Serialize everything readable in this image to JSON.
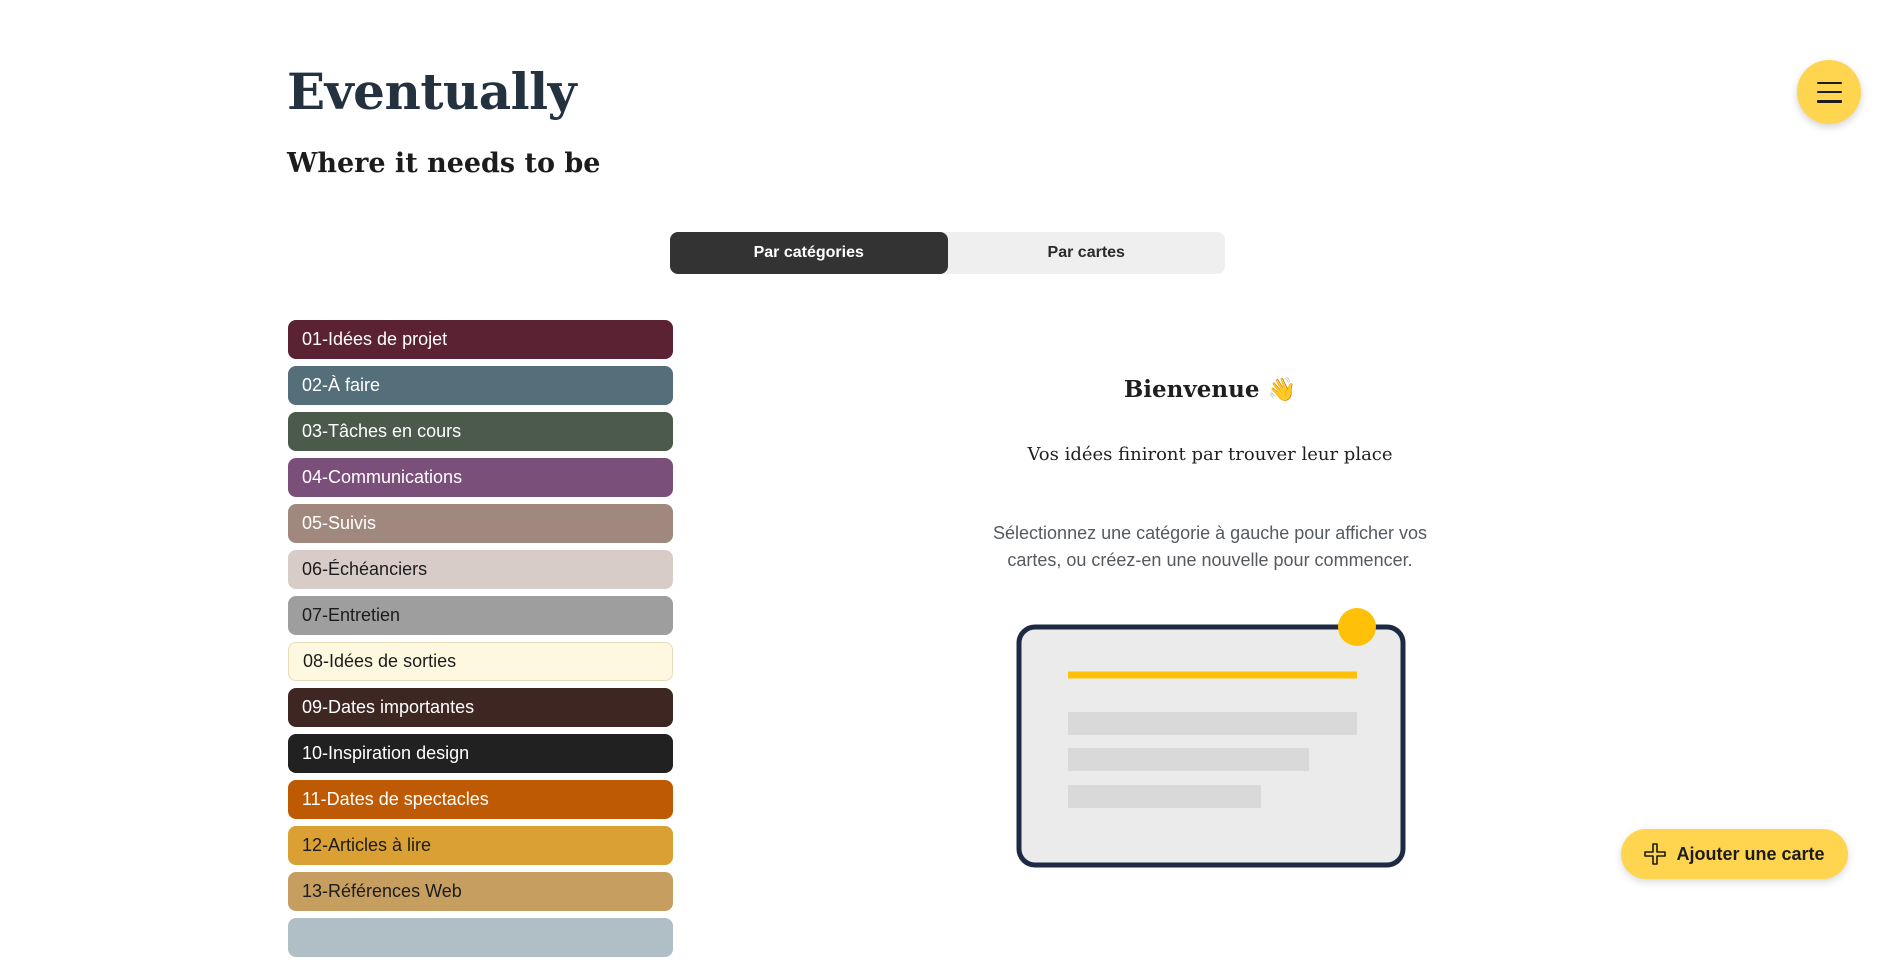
{
  "header": {
    "title": "Eventually",
    "subtitle": "Where it needs to be"
  },
  "menu": {
    "icon": "hamburger-icon"
  },
  "tabs": [
    {
      "label": "Par catégories",
      "active": true
    },
    {
      "label": "Par cartes",
      "active": false
    }
  ],
  "categories": [
    {
      "label": "01-Idées de projet",
      "color": "#5a2233",
      "text_color": "#ffffff"
    },
    {
      "label": "02-À faire",
      "color": "#546e7a",
      "text_color": "#ffffff"
    },
    {
      "label": "03-Tâches en cours",
      "color": "#4b5a4a",
      "text_color": "#ffffff"
    },
    {
      "label": "04-Communications",
      "color": "#7a4f7a",
      "text_color": "#ffffff"
    },
    {
      "label": "05-Suivis",
      "color": "#a1887f",
      "text_color": "#ffffff"
    },
    {
      "label": "06-Échéanciers",
      "color": "#d7ccc8",
      "text_color": "#1c1c1c"
    },
    {
      "label": "07-Entretien",
      "color": "#9e9e9e",
      "text_color": "#1c1c1c"
    },
    {
      "label": "08-Idées de sorties",
      "color": "#fff8e1",
      "text_color": "#1c1c1c"
    },
    {
      "label": "09-Dates importantes",
      "color": "#3e2723",
      "text_color": "#ffffff"
    },
    {
      "label": "10-Inspiration design",
      "color": "#212121",
      "text_color": "#ffffff"
    },
    {
      "label": "11-Dates de spectacles",
      "color": "#bf5a04",
      "text_color": "#ffffff"
    },
    {
      "label": "12-Articles à lire",
      "color": "#dba033",
      "text_color": "#1c1c1c"
    },
    {
      "label": "13-Références Web",
      "color": "#c69e5f",
      "text_color": "#1c1c1c"
    },
    {
      "label": "",
      "color": "#b0bec5",
      "text_color": "#1c1c1c"
    }
  ],
  "welcome": {
    "title": "Bienvenue 👋",
    "subtitle": "Vos idées finiront par trouver leur place",
    "description_line1": "Sélectionnez une catégorie à gauche pour afficher vos",
    "description_line2": "cartes, ou créez-en une nouvelle pour commencer."
  },
  "illustration": {
    "icon": "card-illustration"
  },
  "add_card": {
    "label": "Ajouter une carte",
    "icon": "plus-icon"
  },
  "colors": {
    "accent": "#ffd54f",
    "dark": "#333333",
    "illustration_accent": "#ffc107",
    "illustration_border": "#1e2a44"
  }
}
